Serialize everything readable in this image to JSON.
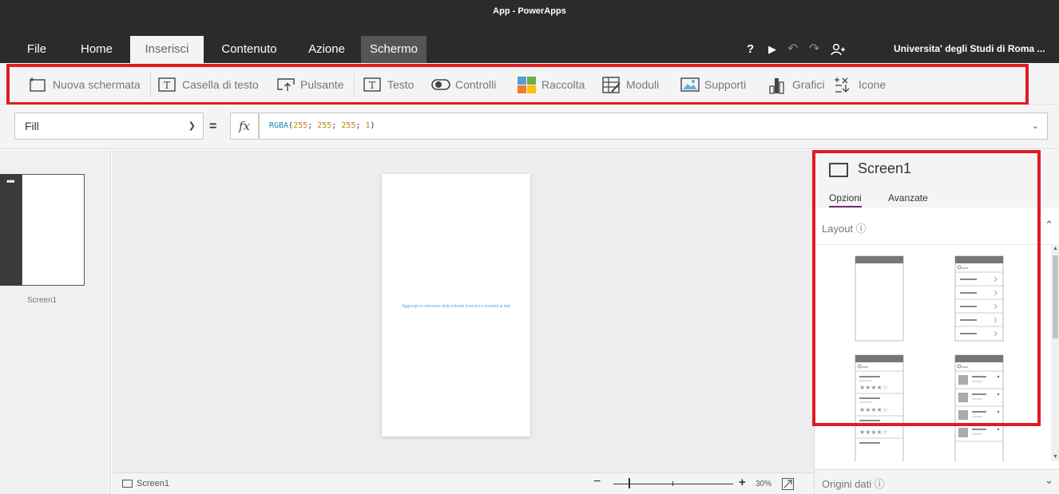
{
  "window": {
    "title": "App - PowerApps"
  },
  "tabs": [
    {
      "label": "File"
    },
    {
      "label": "Home"
    },
    {
      "label": "Inserisci"
    },
    {
      "label": "Contenuto"
    },
    {
      "label": "Azione"
    },
    {
      "label": "Schermo"
    }
  ],
  "topbar": {
    "help_label": "?",
    "play_label": "▶",
    "undo_label": "↶",
    "redo_label": "↷",
    "user_icon": "person-add-icon",
    "account_label": "Universita' degli Studi di Roma ..."
  },
  "toolbar": {
    "items": [
      {
        "label": "Nuova schermata",
        "icon": "new-screen-icon"
      },
      {
        "label": "Casella di testo",
        "icon": "text-box-icon"
      },
      {
        "label": "Pulsante",
        "icon": "button-icon"
      },
      {
        "label": "Testo",
        "icon": "text-icon"
      },
      {
        "label": "Controlli",
        "icon": "toggle-icon"
      },
      {
        "label": "Raccolta",
        "icon": "gallery-icon"
      },
      {
        "label": "Moduli",
        "icon": "forms-icon"
      },
      {
        "label": "Supporti",
        "icon": "media-icon"
      },
      {
        "label": "Grafici",
        "icon": "chart-icon"
      },
      {
        "label": "Icone",
        "icon": "icons-icon"
      }
    ]
  },
  "formula": {
    "property": "Fill",
    "equals": "=",
    "fx_label": "fx",
    "fn": "RGBA",
    "open": "(",
    "args": [
      "255",
      "255",
      "255",
      "1"
    ],
    "sep": "; ",
    "close": ")"
  },
  "left_pane": {
    "dots": "•••",
    "screen_label": "Screen1"
  },
  "canvas": {
    "hint": "Aggiungi un elemento dalla scheda Inserisci o connetti ai dati"
  },
  "statusbar": {
    "screen_label": "Screen1",
    "zoom_minus": "−",
    "zoom_plus": "+",
    "zoom_value": "30%"
  },
  "right_pane": {
    "title": "Screen1",
    "tabs": [
      "Opzioni",
      "Avanzate"
    ],
    "layout_label": "Layout",
    "data_sources_label": "Origini dati"
  },
  "colors": {
    "highlight": "#e01b24",
    "accent": "#742774",
    "hint": "#5aa9e6"
  }
}
